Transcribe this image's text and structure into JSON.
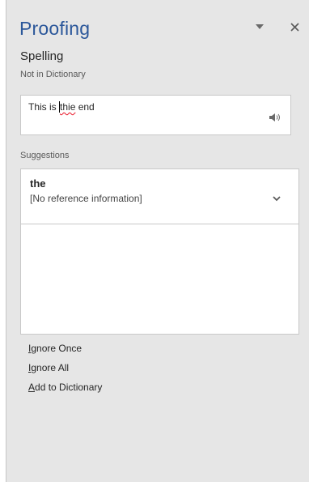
{
  "pane": {
    "title": "Proofing",
    "menu_icon": "chevron-down-icon",
    "close_icon": "close-icon",
    "close_glyph": "✕"
  },
  "spelling": {
    "heading": "Spelling",
    "status": "Not in Dictionary",
    "context_before": "This is ",
    "misspelled_word": "thie",
    "context_after": " end",
    "speaker_icon": "speaker-icon"
  },
  "suggestions": {
    "label": "Suggestions",
    "items": [
      {
        "word": "the",
        "info": "[No reference information]",
        "expand_icon": "chevron-down-icon"
      }
    ]
  },
  "actions": [
    {
      "mnemonic": "I",
      "rest": "gnore Once"
    },
    {
      "mnemonic": "I",
      "rest": "gnore All"
    },
    {
      "mnemonic": "A",
      "rest": "dd to Dictionary"
    }
  ],
  "colors": {
    "title": "#2b579a",
    "pane_background": "#e6e6e6",
    "squiggle": "#e81123"
  }
}
